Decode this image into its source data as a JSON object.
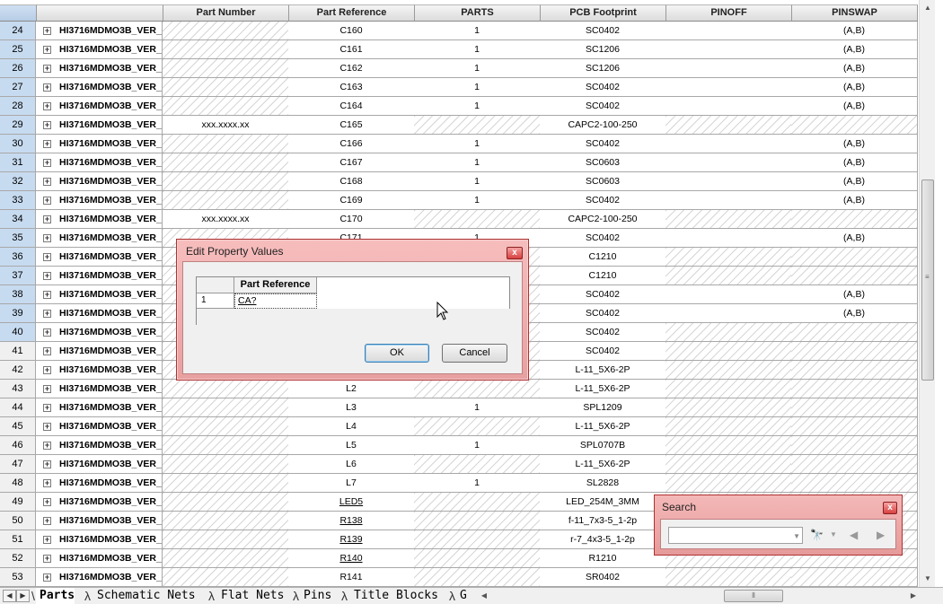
{
  "grid": {
    "columns": [
      "",
      "",
      "Part Number",
      "Part Reference",
      "PARTS",
      "PCB Footprint",
      "PINOFF",
      "PINSWAP"
    ],
    "rows": [
      {
        "num": "24",
        "name": "HI3716MDMO3B_VER_",
        "part_number": "",
        "ref": "C160",
        "parts": "1",
        "footprint": "SC0402",
        "pinswap": "(A,B)"
      },
      {
        "num": "25",
        "name": "HI3716MDMO3B_VER_",
        "part_number": "",
        "ref": "C161",
        "parts": "1",
        "footprint": "SC1206",
        "pinswap": "(A,B)"
      },
      {
        "num": "26",
        "name": "HI3716MDMO3B_VER_",
        "part_number": "",
        "ref": "C162",
        "parts": "1",
        "footprint": "SC1206",
        "pinswap": "(A,B)"
      },
      {
        "num": "27",
        "name": "HI3716MDMO3B_VER_",
        "part_number": "",
        "ref": "C163",
        "parts": "1",
        "footprint": "SC0402",
        "pinswap": "(A,B)"
      },
      {
        "num": "28",
        "name": "HI3716MDMO3B_VER_",
        "part_number": "",
        "ref": "C164",
        "parts": "1",
        "footprint": "SC0402",
        "pinswap": "(A,B)"
      },
      {
        "num": "29",
        "name": "HI3716MDMO3B_VER_",
        "part_number": "xxx.xxxx.xx",
        "ref": "C165",
        "parts": "",
        "footprint": "CAPC2-100-250",
        "pinswap": ""
      },
      {
        "num": "30",
        "name": "HI3716MDMO3B_VER_",
        "part_number": "",
        "ref": "C166",
        "parts": "1",
        "footprint": "SC0402",
        "pinswap": "(A,B)"
      },
      {
        "num": "31",
        "name": "HI3716MDMO3B_VER_",
        "part_number": "",
        "ref": "C167",
        "parts": "1",
        "footprint": "SC0603",
        "pinswap": "(A,B)"
      },
      {
        "num": "32",
        "name": "HI3716MDMO3B_VER_",
        "part_number": "",
        "ref": "C168",
        "parts": "1",
        "footprint": "SC0603",
        "pinswap": "(A,B)"
      },
      {
        "num": "33",
        "name": "HI3716MDMO3B_VER_",
        "part_number": "",
        "ref": "C169",
        "parts": "1",
        "footprint": "SC0402",
        "pinswap": "(A,B)"
      },
      {
        "num": "34",
        "name": "HI3716MDMO3B_VER_",
        "part_number": "xxx.xxxx.xx",
        "ref": "C170",
        "parts": "",
        "footprint": "CAPC2-100-250",
        "pinswap": ""
      },
      {
        "num": "35",
        "name": "HI3716MDMO3B_VER_",
        "part_number": "",
        "ref": "C171",
        "parts": "1",
        "footprint": "SC0402",
        "pinswap": "(A,B)"
      },
      {
        "num": "36",
        "name": "HI3716MDMO3B_VER_",
        "part_number": "",
        "ref": "",
        "parts": "",
        "footprint": "C1210",
        "pinswap": ""
      },
      {
        "num": "37",
        "name": "HI3716MDMO3B_VER_",
        "part_number": "",
        "ref": "",
        "parts": "",
        "footprint": "C1210",
        "pinswap": ""
      },
      {
        "num": "38",
        "name": "HI3716MDMO3B_VER_",
        "part_number": "",
        "ref": "",
        "parts": "",
        "footprint": "SC0402",
        "pinswap": "(A,B)"
      },
      {
        "num": "39",
        "name": "HI3716MDMO3B_VER_",
        "part_number": "",
        "ref": "",
        "parts": "",
        "footprint": "SC0402",
        "pinswap": "(A,B)"
      },
      {
        "num": "40",
        "name": "HI3716MDMO3B_VER_",
        "part_number": "",
        "ref": "",
        "parts": "",
        "footprint": "SC0402",
        "pinswap": ""
      },
      {
        "num": "41",
        "name": "HI3716MDMO3B_VER_",
        "part_number": "",
        "ref": "",
        "parts": "",
        "footprint": "SC0402",
        "pinswap": ""
      },
      {
        "num": "42",
        "name": "HI3716MDMO3B_VER_",
        "part_number": "",
        "ref": "",
        "parts": "",
        "footprint": "L-11_5X6-2P",
        "pinswap": ""
      },
      {
        "num": "43",
        "name": "HI3716MDMO3B_VER_",
        "part_number": "",
        "ref": "L2",
        "parts": "",
        "footprint": "L-11_5X6-2P",
        "pinswap": ""
      },
      {
        "num": "44",
        "name": "HI3716MDMO3B_VER_",
        "part_number": "",
        "ref": "L3",
        "parts": "1",
        "footprint": "SPL1209",
        "pinswap": ""
      },
      {
        "num": "45",
        "name": "HI3716MDMO3B_VER_",
        "part_number": "",
        "ref": "L4",
        "parts": "",
        "footprint": "L-11_5X6-2P",
        "pinswap": ""
      },
      {
        "num": "46",
        "name": "HI3716MDMO3B_VER_",
        "part_number": "",
        "ref": "L5",
        "parts": "1",
        "footprint": "SPL0707B",
        "pinswap": ""
      },
      {
        "num": "47",
        "name": "HI3716MDMO3B_VER_",
        "part_number": "",
        "ref": "L6",
        "parts": "",
        "footprint": "L-11_5X6-2P",
        "pinswap": ""
      },
      {
        "num": "48",
        "name": "HI3716MDMO3B_VER_",
        "part_number": "",
        "ref": "L7",
        "parts": "1",
        "footprint": "SL2828",
        "pinswap": ""
      },
      {
        "num": "49",
        "name": "HI3716MDMO3B_VER_",
        "part_number": "",
        "ref": "LED5",
        "parts": "",
        "footprint": "LED_254M_3MM",
        "pinswap": ""
      },
      {
        "num": "50",
        "name": "HI3716MDMO3B_VER_",
        "part_number": "",
        "ref": "R138",
        "parts": "",
        "footprint": "f-11_7x3-5_1-2p",
        "pinswap": ""
      },
      {
        "num": "51",
        "name": "HI3716MDMO3B_VER_",
        "part_number": "",
        "ref": "R139",
        "parts": "",
        "footprint": "r-7_4x3-5_1-2p",
        "pinswap": ""
      },
      {
        "num": "52",
        "name": "HI3716MDMO3B_VER_",
        "part_number": "",
        "ref": "R140",
        "parts": "",
        "footprint": "R1210",
        "pinswap": ""
      },
      {
        "num": "53",
        "name": "HI3716MDMO3B_VER_",
        "part_number": "",
        "ref": "R141",
        "parts": "",
        "footprint": "SR0402",
        "pinswap": ""
      }
    ]
  },
  "tabs": [
    {
      "label": "Parts",
      "active": true
    },
    {
      "label": "Schematic Nets",
      "active": false
    },
    {
      "label": "Flat Nets",
      "active": false
    },
    {
      "label": "Pins",
      "active": false
    },
    {
      "label": "Title Blocks",
      "active": false
    },
    {
      "label": "G",
      "active": false
    }
  ],
  "dialog": {
    "title": "Edit Property Values",
    "column_header": "Part Reference",
    "row_number": "1",
    "value": "CA?",
    "ok_label": "OK",
    "cancel_label": "Cancel",
    "close_label": "x"
  },
  "search": {
    "title": "Search",
    "value": "",
    "close_label": "x"
  },
  "colors": {
    "selected_row": "#c7dbf0",
    "dialog_frame": "#e8a0a0",
    "hatch": "#d6d6d6"
  },
  "icons": {
    "expand": "plus-box-icon",
    "find": "binoculars-icon",
    "prev": "prev-arrow-icon",
    "next": "next-arrow-icon"
  }
}
